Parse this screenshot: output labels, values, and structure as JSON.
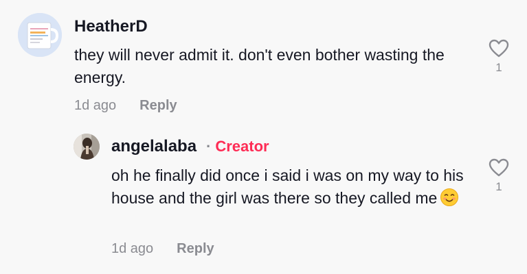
{
  "comments": [
    {
      "username": "HeatherD",
      "text": "they will never admit it. don't even bother wasting the energy.",
      "time": "1d ago",
      "reply_label": "Reply",
      "like_count": "1",
      "avatar_icon": "mug-avatar"
    }
  ],
  "reply": {
    "username": "angelalaba",
    "badge_separator": "·",
    "badge": "Creator",
    "text": "oh he finally did once i said i was on my way to his house and the girl was there so they called me",
    "emoji_icon": "smiling-face-emoji",
    "time": "1d ago",
    "reply_label": "Reply",
    "like_count": "1",
    "avatar_icon": "person-avatar"
  },
  "colors": {
    "background": "#f8f8f8",
    "text": "#161823",
    "secondary": "#8a8b91",
    "creator": "#fe2c55"
  }
}
